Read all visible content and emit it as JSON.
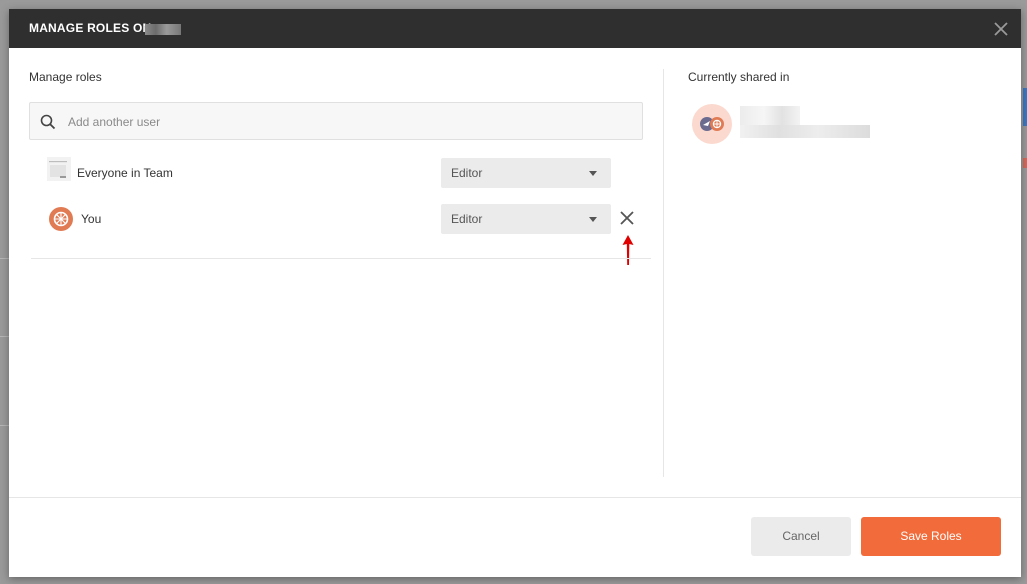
{
  "dialog": {
    "title": "MANAGE ROLES ON",
    "close_icon": "close-icon"
  },
  "manage": {
    "heading": "Manage roles",
    "search": {
      "placeholder": "Add another user",
      "value": "",
      "icon": "search-icon"
    },
    "members": [
      {
        "label": "Everyone in Team",
        "role": "Editor",
        "icon": "team-logo-icon"
      },
      {
        "label": "You",
        "role": "Editor",
        "icon": "user-avatar-icon",
        "remove_icon": "close-icon"
      }
    ]
  },
  "shared": {
    "heading": "Currently shared in"
  },
  "footer": {
    "cancel_label": "Cancel",
    "save_label": "Save Roles"
  },
  "colors": {
    "header_bg": "#2f2f2f",
    "accent": "#f26b3a",
    "avatar_orange": "#e07b54",
    "annotation_arrow": "#e00000"
  }
}
